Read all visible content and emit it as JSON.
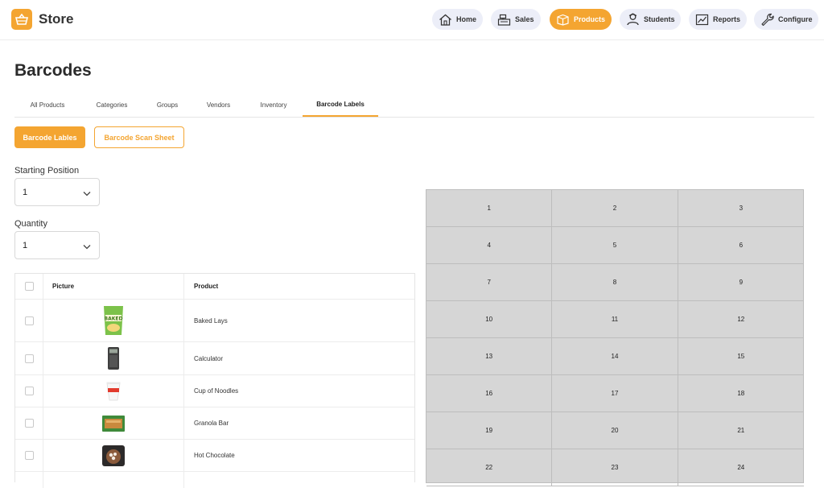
{
  "app": {
    "name": "Store",
    "accent": "#f4a531"
  },
  "nav": [
    {
      "label": "Home",
      "icon": "home-icon",
      "active": false
    },
    {
      "label": "Sales",
      "icon": "cash-register-icon",
      "active": false
    },
    {
      "label": "Products",
      "icon": "box-icon",
      "active": true
    },
    {
      "label": "Students",
      "icon": "student-icon",
      "active": false
    },
    {
      "label": "Reports",
      "icon": "chart-icon",
      "active": false
    },
    {
      "label": "Configure",
      "icon": "wrench-icon",
      "active": false
    }
  ],
  "page": {
    "title": "Barcodes"
  },
  "tabs": [
    {
      "label": "All Products",
      "active": false
    },
    {
      "label": "Categories",
      "active": false
    },
    {
      "label": "Groups",
      "active": false
    },
    {
      "label": "Vendors",
      "active": false
    },
    {
      "label": "Inventory",
      "active": false
    },
    {
      "label": "Barcode Labels",
      "active": true
    }
  ],
  "buttons": {
    "labels": "Barcode Lables",
    "scan_sheet": "Barcode Scan Sheet"
  },
  "form": {
    "starting_position": {
      "label": "Starting Position",
      "value": "1"
    },
    "quantity": {
      "label": "Quantity",
      "value": "1"
    }
  },
  "table": {
    "headers": {
      "picture": "Picture",
      "product": "Product"
    },
    "rows": [
      {
        "name": "Baked Lays",
        "image": "chips-bag-image"
      },
      {
        "name": "Calculator",
        "image": "calculator-image"
      },
      {
        "name": "Cup of Noodles",
        "image": "noodle-cup-image"
      },
      {
        "name": "Granola Bar",
        "image": "granola-bar-image"
      },
      {
        "name": "Hot Chocolate",
        "image": "hot-chocolate-image"
      }
    ]
  },
  "label_grid": {
    "columns": 3,
    "cells": [
      "1",
      "2",
      "3",
      "4",
      "5",
      "6",
      "7",
      "8",
      "9",
      "10",
      "11",
      "12",
      "13",
      "14",
      "15",
      "16",
      "17",
      "18",
      "19",
      "20",
      "21",
      "22",
      "23",
      "24"
    ]
  }
}
